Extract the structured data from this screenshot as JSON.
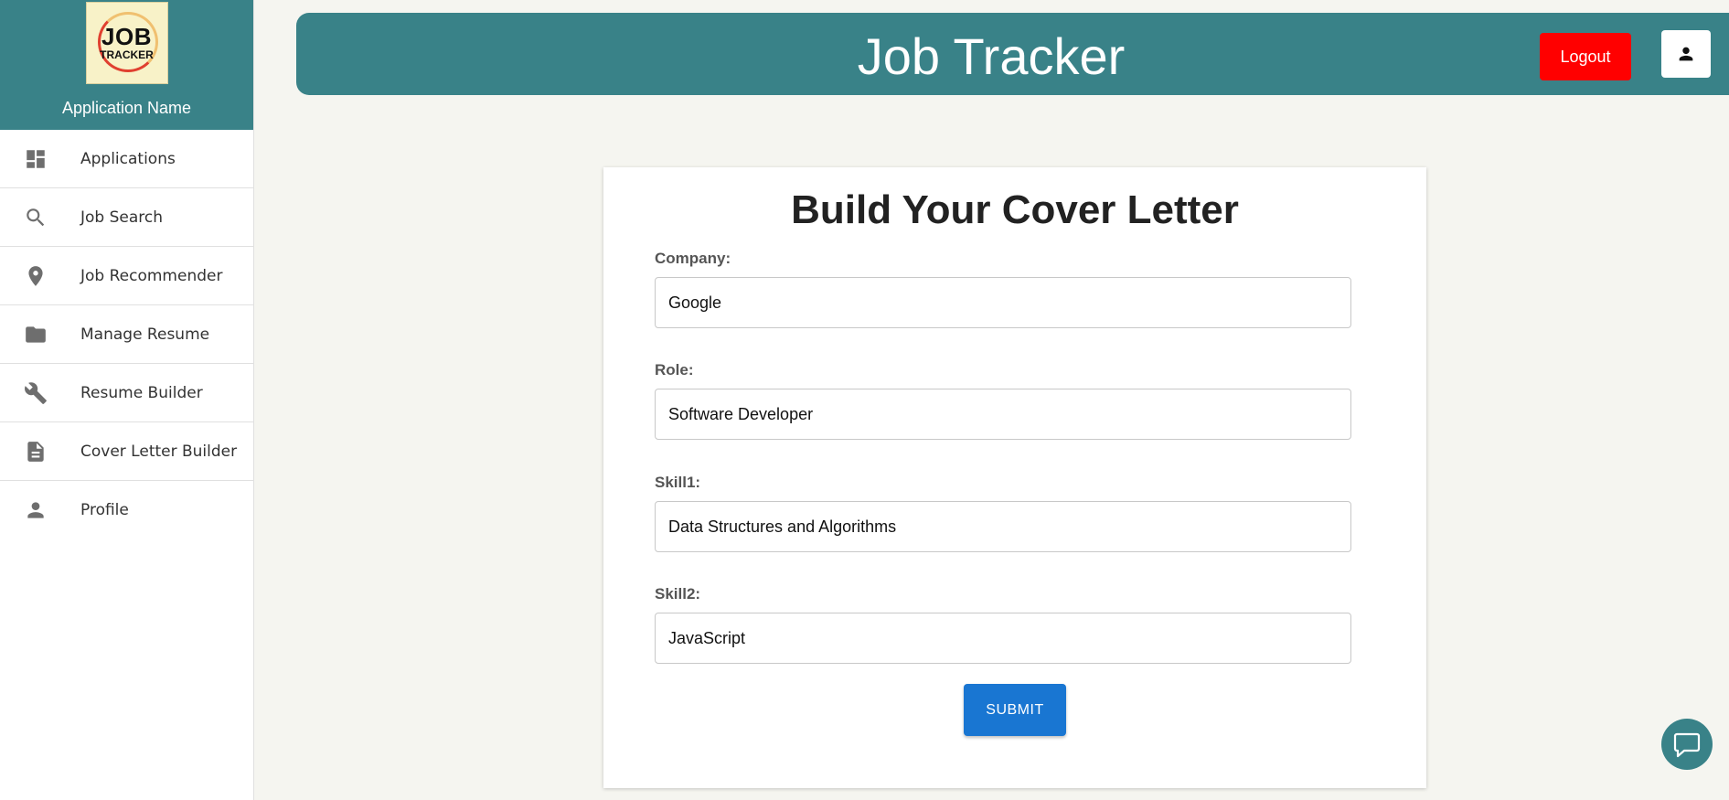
{
  "sidebar": {
    "logo": {
      "line1": "JOB",
      "line2": "TRACKER"
    },
    "app_name": "Application Name",
    "items": [
      {
        "label": "Applications",
        "icon": "dashboard-icon"
      },
      {
        "label": "Job Search",
        "icon": "search-icon"
      },
      {
        "label": "Job Recommender",
        "icon": "location-pin-icon"
      },
      {
        "label": "Manage Resume",
        "icon": "folder-icon"
      },
      {
        "label": "Resume Builder",
        "icon": "wrench-icon"
      },
      {
        "label": "Cover Letter Builder",
        "icon": "document-icon"
      },
      {
        "label": "Profile",
        "icon": "person-icon"
      }
    ]
  },
  "header": {
    "title": "Job Tracker",
    "logout_label": "Logout",
    "profile_icon": "person-icon"
  },
  "form": {
    "title": "Build Your Cover Letter",
    "fields": [
      {
        "label": "Company:",
        "value": "Google"
      },
      {
        "label": "Role:",
        "value": "Software Developer"
      },
      {
        "label": "Skill1:",
        "value": "Data Structures and Algorithms"
      },
      {
        "label": "Skill2:",
        "value": "JavaScript"
      }
    ],
    "submit_label": "SUBMIT"
  },
  "chat": {
    "icon": "chat-bubble-icon"
  },
  "colors": {
    "primary": "#398288",
    "logout": "#ff0000",
    "submit": "#1976d2",
    "background": "#f5f5f0"
  }
}
